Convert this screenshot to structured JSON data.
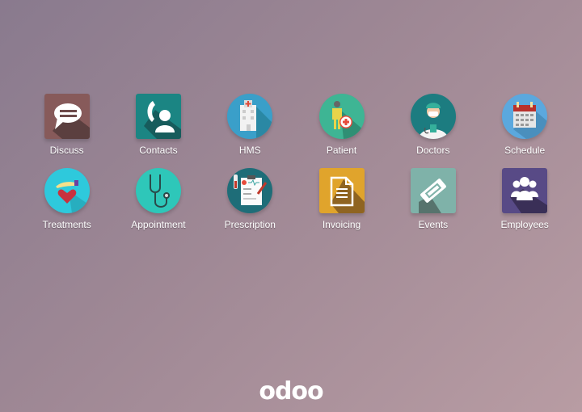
{
  "apps": [
    {
      "name": "Discuss",
      "icon": "speech-bubble-icon",
      "color": "#875a5a"
    },
    {
      "name": "Contacts",
      "icon": "contact-phone-icon",
      "color": "#1b8583"
    },
    {
      "name": "HMS",
      "icon": "hospital-icon",
      "color": "#3a9fc9"
    },
    {
      "name": "Patient",
      "icon": "patient-icon",
      "color": "#3eb594"
    },
    {
      "name": "Doctors",
      "icon": "doctor-icon",
      "color": "#1c7c80"
    },
    {
      "name": "Schedule",
      "icon": "calendar-icon",
      "color": "#5ba8de"
    },
    {
      "name": "Treatments",
      "icon": "hand-heart-icon",
      "color": "#2ec9dc"
    },
    {
      "name": "Appointment",
      "icon": "stethoscope-icon",
      "color": "#2ec7b9"
    },
    {
      "name": "Prescription",
      "icon": "clipboard-icon",
      "color": "#1e6d78"
    },
    {
      "name": "Invoicing",
      "icon": "document-icon",
      "color": "#e0a42c"
    },
    {
      "name": "Events",
      "icon": "ticket-icon",
      "color": "#7fb2a9"
    },
    {
      "name": "Employees",
      "icon": "people-group-icon",
      "color": "#584a86"
    }
  ],
  "footer": {
    "logo": "odoo"
  }
}
